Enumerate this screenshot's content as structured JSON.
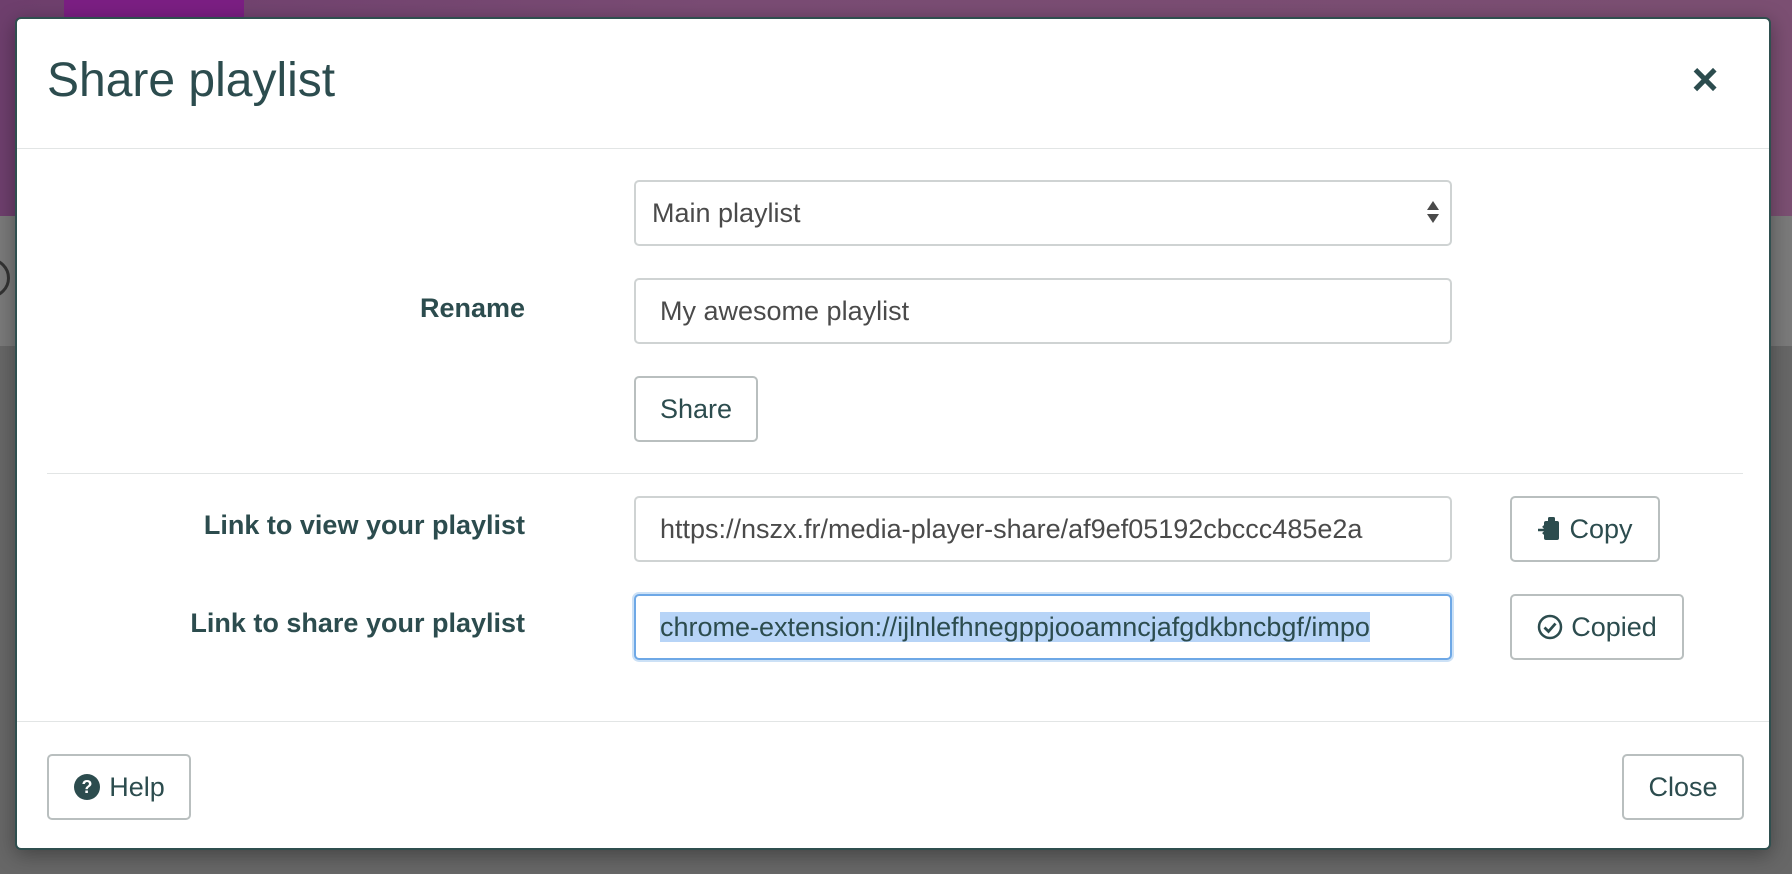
{
  "dialog": {
    "title": "Share playlist"
  },
  "form": {
    "playlist_select": {
      "value": "Main playlist"
    },
    "rename": {
      "label": "Rename",
      "value": "My awesome playlist"
    },
    "share_button": "Share",
    "view_link": {
      "label": "Link to view your playlist",
      "value": "https://nszx.fr/media-player-share/af9ef05192cbccc485e2a",
      "button": "Copy"
    },
    "share_link": {
      "label": "Link to share your playlist",
      "value": "chrome-extension://ijlnlefhnegppjooamncjafgdkbncbgf/impo",
      "button": "Copied"
    }
  },
  "footer": {
    "help_button": "Help",
    "close_button": "Close"
  },
  "colors": {
    "text": "#2c4c4e",
    "focus_border": "#6ea8e6",
    "selection": "#b7d4f7"
  }
}
